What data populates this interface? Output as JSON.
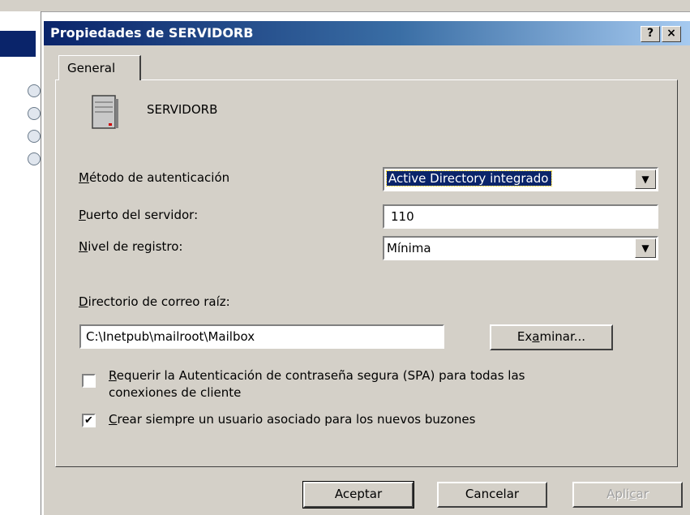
{
  "dialog": {
    "title": "Propiedades de SERVIDORB",
    "help_button": "?",
    "close_button": "×"
  },
  "tabs": [
    {
      "label": "General",
      "active": true
    }
  ],
  "server": {
    "name": "SERVIDORB",
    "icon": "server-icon"
  },
  "fields": {
    "auth_method": {
      "label_accel": "M",
      "label_rest": "étodo de autenticación",
      "value": "Active Directory integrado"
    },
    "server_port": {
      "label_accel": "P",
      "label_rest": "uerto del servidor:",
      "value": "110"
    },
    "log_level": {
      "label_accel": "N",
      "label_rest": "ivel de registro:",
      "value": "Mínima"
    },
    "mail_root": {
      "label_accel": "D",
      "label_rest": "irectorio de correo raíz:",
      "value": "C:\\Inetpub\\mailroot\\Mailbox"
    }
  },
  "browse_button": {
    "pre": "Ex",
    "accel": "a",
    "post": "minar..."
  },
  "checkboxes": {
    "require_spa": {
      "checked": false,
      "accel": "R",
      "line1_rest": "equerir la Autenticación de contraseña segura (SPA) para todas las",
      "line2": "conexiones de cliente"
    },
    "create_user": {
      "checked": true,
      "accel": "C",
      "rest": "rear siempre un usuario asociado para los nuevos buzones",
      "mark": "✔"
    }
  },
  "footer": {
    "ok": "Aceptar",
    "cancel": "Cancelar",
    "apply_pre": "Apli",
    "apply_accel": "c",
    "apply_post": "ar"
  },
  "colors": {
    "titlebar_start": "#0a246a",
    "titlebar_end": "#a6caf0",
    "face": "#d4d0c8",
    "selection": "#0a246a"
  }
}
